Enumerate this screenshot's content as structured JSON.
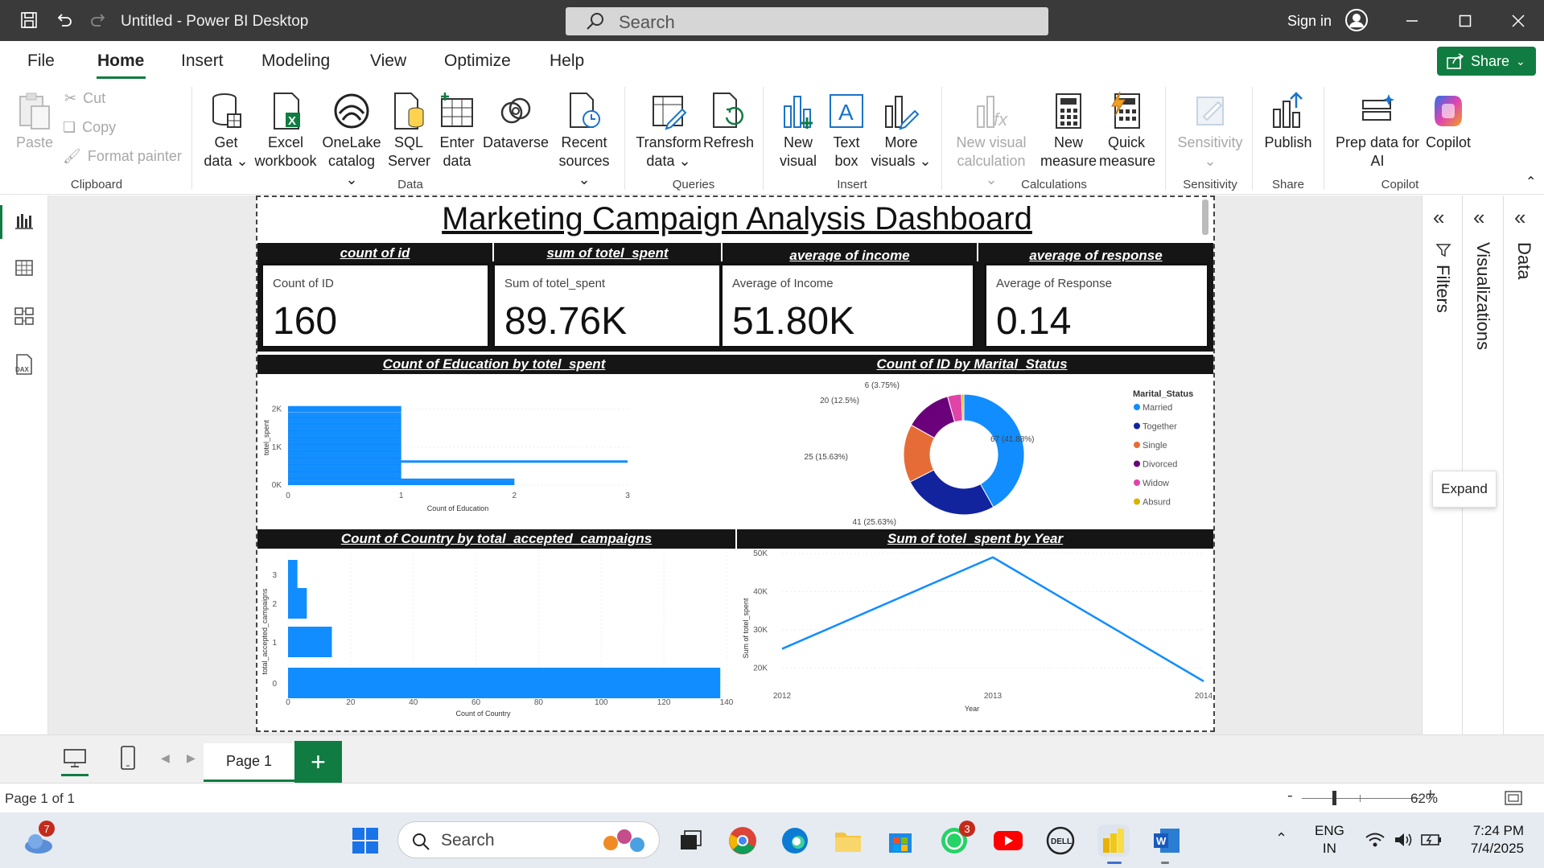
{
  "window": {
    "title": "Untitled - Power BI Desktop",
    "search_placeholder": "Search",
    "sign_in": "Sign in"
  },
  "menu": {
    "items": [
      "File",
      "Home",
      "Insert",
      "Modeling",
      "View",
      "Optimize",
      "Help"
    ],
    "share": "Share"
  },
  "ribbon": {
    "clipboard": {
      "paste": "Paste",
      "cut": "Cut",
      "copy": "Copy",
      "format_painter": "Format painter",
      "group": "Clipboard"
    },
    "data": {
      "get_data": [
        "Get",
        "data"
      ],
      "excel": [
        "Excel",
        "workbook"
      ],
      "onelake": [
        "OneLake",
        "catalog"
      ],
      "sql": [
        "SQL",
        "Server"
      ],
      "enter": [
        "Enter",
        "data"
      ],
      "dataverse": "Dataverse",
      "recent": [
        "Recent",
        "sources"
      ],
      "group": "Data"
    },
    "queries": {
      "transform": [
        "Transform",
        "data"
      ],
      "refresh": "Refresh",
      "group": "Queries"
    },
    "insert": {
      "new_visual": [
        "New",
        "visual"
      ],
      "text_box": [
        "Text",
        "box"
      ],
      "more_visuals": [
        "More",
        "visuals"
      ],
      "group": "Insert"
    },
    "calculations": {
      "new_visual_calc": [
        "New visual",
        "calculation"
      ],
      "new_measure": [
        "New",
        "measure"
      ],
      "quick_measure": [
        "Quick",
        "measure"
      ],
      "group": "Calculations"
    },
    "sensitivity": {
      "label": "Sensitivity",
      "group": "Sensitivity"
    },
    "share": {
      "publish": "Publish",
      "group": "Share"
    },
    "copilot": {
      "prep": [
        "Prep data for",
        "AI"
      ],
      "copilot": "Copilot",
      "group": "Copilot"
    }
  },
  "report": {
    "title": "Marketing Campaign Analysis Dashboard",
    "cards": [
      {
        "header": "count of id",
        "label": "Count of ID",
        "value": "160"
      },
      {
        "header": "sum of totel_spent",
        "label": "Sum of totel_spent",
        "value": "89.76K"
      },
      {
        "header": "average of income",
        "label": "Average of Income",
        "value": "51.80K"
      },
      {
        "header": "average of response",
        "label": "Average of Response",
        "value": "0.14"
      }
    ],
    "headers": {
      "edu": "Count of Education by totel_spent",
      "marital": "Count of ID by Marital_Status",
      "country": "Count of Country by total_accepted_campaigns",
      "year": "Sum of totel_spent by Year"
    }
  },
  "chart_data": [
    {
      "type": "bar",
      "orientation": "horizontal",
      "title": "Count of Education by totel_spent",
      "xlabel": "Count of Education",
      "ylabel": "totel_spent",
      "xlim": [
        0,
        3
      ],
      "x_ticks": [
        "0",
        "1",
        "2",
        "3"
      ],
      "y_ticks": [
        "2K",
        "1K",
        "0K"
      ],
      "ylim": [
        0,
        2500
      ],
      "series_note": "many thin bars",
      "bars": [
        {
          "y": 2050,
          "x": 1
        },
        {
          "y": 2000,
          "x": 1
        },
        {
          "y": 1950,
          "x": 1
        },
        {
          "y": 1880,
          "x": 1
        },
        {
          "y": 1820,
          "x": 1
        },
        {
          "y": 1760,
          "x": 1
        },
        {
          "y": 1700,
          "x": 1
        },
        {
          "y": 1640,
          "x": 1
        },
        {
          "y": 1580,
          "x": 1
        },
        {
          "y": 1520,
          "x": 1
        },
        {
          "y": 1460,
          "x": 1
        },
        {
          "y": 1400,
          "x": 1
        },
        {
          "y": 1340,
          "x": 1
        },
        {
          "y": 1280,
          "x": 1
        },
        {
          "y": 1220,
          "x": 1
        },
        {
          "y": 1160,
          "x": 1
        },
        {
          "y": 1100,
          "x": 1
        },
        {
          "y": 1040,
          "x": 1
        },
        {
          "y": 980,
          "x": 1
        },
        {
          "y": 920,
          "x": 1
        },
        {
          "y": 860,
          "x": 1
        },
        {
          "y": 800,
          "x": 1
        },
        {
          "y": 740,
          "x": 1
        },
        {
          "y": 680,
          "x": 1
        },
        {
          "y": 620,
          "x": 3
        },
        {
          "y": 560,
          "x": 1
        },
        {
          "y": 500,
          "x": 1
        },
        {
          "y": 440,
          "x": 1
        },
        {
          "y": 380,
          "x": 1
        },
        {
          "y": 320,
          "x": 1
        },
        {
          "y": 260,
          "x": 1
        },
        {
          "y": 200,
          "x": 1
        },
        {
          "y": 140,
          "x": 2
        },
        {
          "y": 80,
          "x": 2
        },
        {
          "y": 30,
          "x": 2
        }
      ]
    },
    {
      "type": "pie",
      "variant": "donut",
      "title": "Count of ID by Marital_Status",
      "legend_title": "Marital_Status",
      "legend_position": "right",
      "slices": [
        {
          "name": "Married",
          "value": 67,
          "label": "67 (41.88%)",
          "color": "#118DFF"
        },
        {
          "name": "Together",
          "value": 41,
          "label": "41 (25.63%)",
          "color": "#12239E"
        },
        {
          "name": "Single",
          "value": 25,
          "label": "25 (15.63%)",
          "color": "#E66C37"
        },
        {
          "name": "Divorced",
          "value": 20,
          "label": "20 (12.5%)",
          "color": "#6B007B"
        },
        {
          "name": "Widow",
          "value": 6,
          "label": "6 (3.75%)",
          "color": "#E044A7"
        },
        {
          "name": "Absurd",
          "value": 1,
          "label": "",
          "color": "#D9B300"
        }
      ]
    },
    {
      "type": "bar",
      "orientation": "horizontal",
      "title": "Count of Country by total_accepted_campaigns",
      "xlabel": "Count of Country",
      "ylabel": "total_accepted_campaigns",
      "categories": [
        "3",
        "2",
        "1",
        "0"
      ],
      "values": [
        3,
        6,
        14,
        138
      ],
      "xlim": [
        0,
        140
      ],
      "x_ticks": [
        "0",
        "20",
        "40",
        "60",
        "80",
        "100",
        "120",
        "140"
      ]
    },
    {
      "type": "line",
      "title": "Sum of totel_spent by Year",
      "xlabel": "Year",
      "ylabel": "Sum of totel_spent",
      "x": [
        "2012",
        "2013",
        "2014"
      ],
      "values": [
        25000,
        49000,
        16500
      ],
      "ylim": [
        15000,
        50000
      ],
      "y_ticks": [
        {
          "v": 50000,
          "t": "50K"
        },
        {
          "v": 40000,
          "t": "40K"
        },
        {
          "v": 30000,
          "t": "30K"
        },
        {
          "v": 20000,
          "t": "20K"
        }
      ]
    }
  ],
  "panes": {
    "filters": "Filters",
    "visualizations": "Visualizations",
    "data": "Data",
    "expand_tip": "Expand"
  },
  "pages": {
    "tab": "Page 1",
    "indicator": "Page 1 of 1",
    "zoom": "62%"
  },
  "taskbar": {
    "search": "Search",
    "weather_badge": "7",
    "whatsapp_badge": "3",
    "lang": [
      "ENG",
      "IN"
    ],
    "time": "7:24 PM",
    "date": "7/4/2025"
  },
  "colors": {
    "accent": "#107c41",
    "series": "#118DFF"
  }
}
